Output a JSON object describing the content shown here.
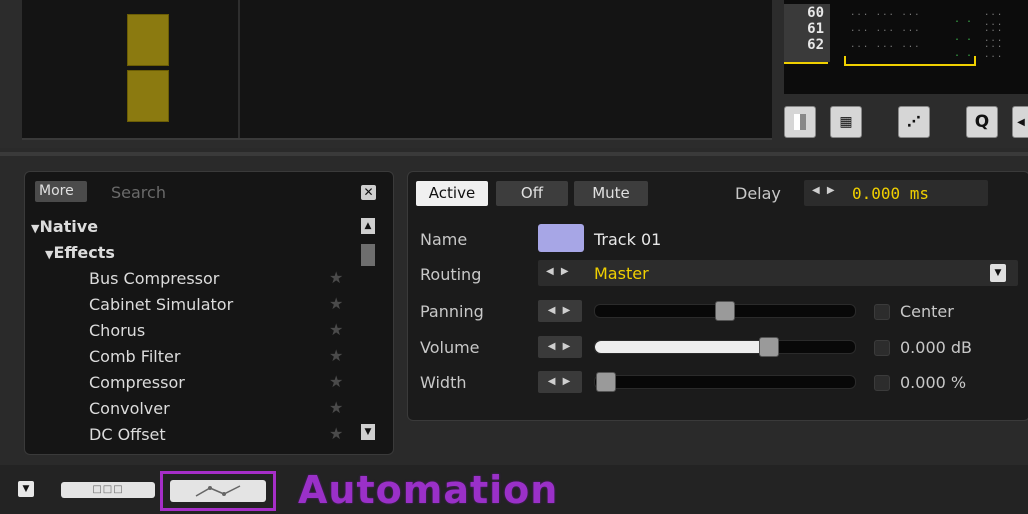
{
  "tracker": {
    "rows": [
      "60",
      "61",
      "62"
    ],
    "cells": [
      "... ... ...",
      "... ... ...",
      "... ... ..."
    ]
  },
  "browser": {
    "more_label": "More",
    "search_placeholder": "Search",
    "tree": [
      {
        "label": "Native",
        "level": 0,
        "expanded": true
      },
      {
        "label": "Effects",
        "level": 1,
        "expanded": true
      },
      {
        "label": "Bus Compressor",
        "level": 2
      },
      {
        "label": "Cabinet Simulator",
        "level": 2
      },
      {
        "label": "Chorus",
        "level": 2
      },
      {
        "label": "Comb Filter",
        "level": 2
      },
      {
        "label": "Compressor",
        "level": 2
      },
      {
        "label": "Convolver",
        "level": 2
      },
      {
        "label": "DC Offset",
        "level": 2
      }
    ]
  },
  "mixer": {
    "state_buttons": [
      "Active",
      "Off",
      "Mute"
    ],
    "active_state": "Active",
    "delay_label": "Delay",
    "delay_value": "0.000 ms",
    "name_label": "Name",
    "name_value": "Track 01",
    "track_color": "#a7a6e6",
    "routing_label": "Routing",
    "routing_value": "Master",
    "panning_label": "Panning",
    "panning_fraction": 0.5,
    "panning_check_label": "Center",
    "volume_label": "Volume",
    "volume_fraction": 0.68,
    "volume_value": "0.000 dB",
    "width_label": "Width",
    "width_fraction": 0.0,
    "width_value": "0.000 %"
  },
  "bottom": {
    "automation_label": "Automation"
  },
  "colors": {
    "clip_color": "#8b7a10",
    "highlight_yellow": "#f0d000",
    "automation_purple": "#9a30c8",
    "routing_text": "#f0d000",
    "delay_text": "#f0d000"
  }
}
